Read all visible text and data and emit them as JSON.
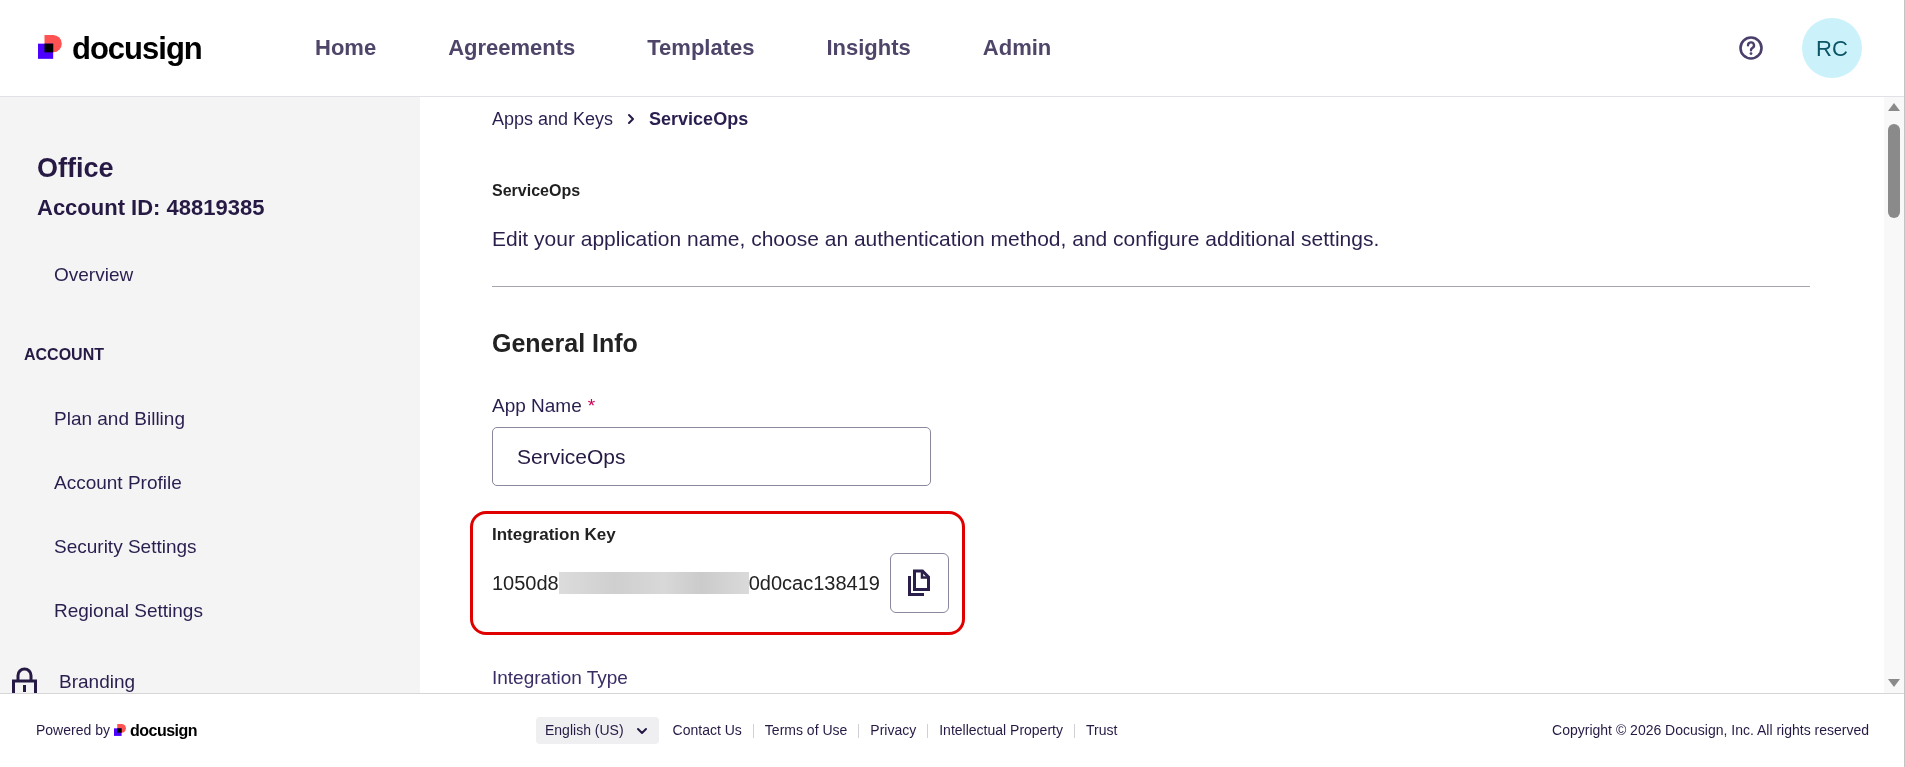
{
  "header": {
    "logo_text": "docusign",
    "nav": [
      {
        "label": "Home",
        "selected": false
      },
      {
        "label": "Agreements",
        "selected": false
      },
      {
        "label": "Templates",
        "selected": false
      },
      {
        "label": "Insights",
        "selected": false
      },
      {
        "label": "Admin",
        "selected": false
      }
    ],
    "avatar_initials": "RC"
  },
  "sidebar": {
    "title": "Office",
    "account_id": "Account ID: 48819385",
    "items": [
      {
        "label": "Overview",
        "selected": false,
        "locked": false
      }
    ],
    "sections": [
      {
        "heading": "ACCOUNT",
        "items": [
          {
            "label": "Plan and Billing",
            "selected": false,
            "locked": false
          },
          {
            "label": "Account Profile",
            "selected": false,
            "locked": false
          },
          {
            "label": "Security Settings",
            "selected": false,
            "locked": false
          },
          {
            "label": "Regional Settings",
            "selected": false,
            "locked": false
          },
          {
            "label": "Branding",
            "selected": false,
            "locked": true
          }
        ]
      }
    ]
  },
  "breadcrumb": [
    {
      "label": "Apps and Keys",
      "current": false
    },
    {
      "label": "ServiceOps",
      "current": true
    }
  ],
  "page": {
    "app_title": "ServiceOps",
    "description": "Edit your application name, choose an authentication method, and configure additional settings.",
    "section_title": "General Info"
  },
  "form": {
    "app_name": {
      "label": "App Name",
      "required_mark": "*",
      "value": "ServiceOps"
    },
    "integration_key": {
      "label": "Integration Key",
      "value_start": "1050d8",
      "value_end": "0d0cac138419",
      "redacted": true,
      "highlighted": true
    },
    "integration_type": {
      "label": "Integration Type"
    }
  },
  "footer": {
    "powered_by": "Powered by",
    "logo_text": "docusign",
    "language": "English (US)",
    "links": [
      "Contact Us",
      "Terms of Use",
      "Privacy",
      "Intellectual Property",
      "Trust"
    ],
    "copyright": "Copyright © 2026 Docusign, Inc. All rights reserved"
  }
}
